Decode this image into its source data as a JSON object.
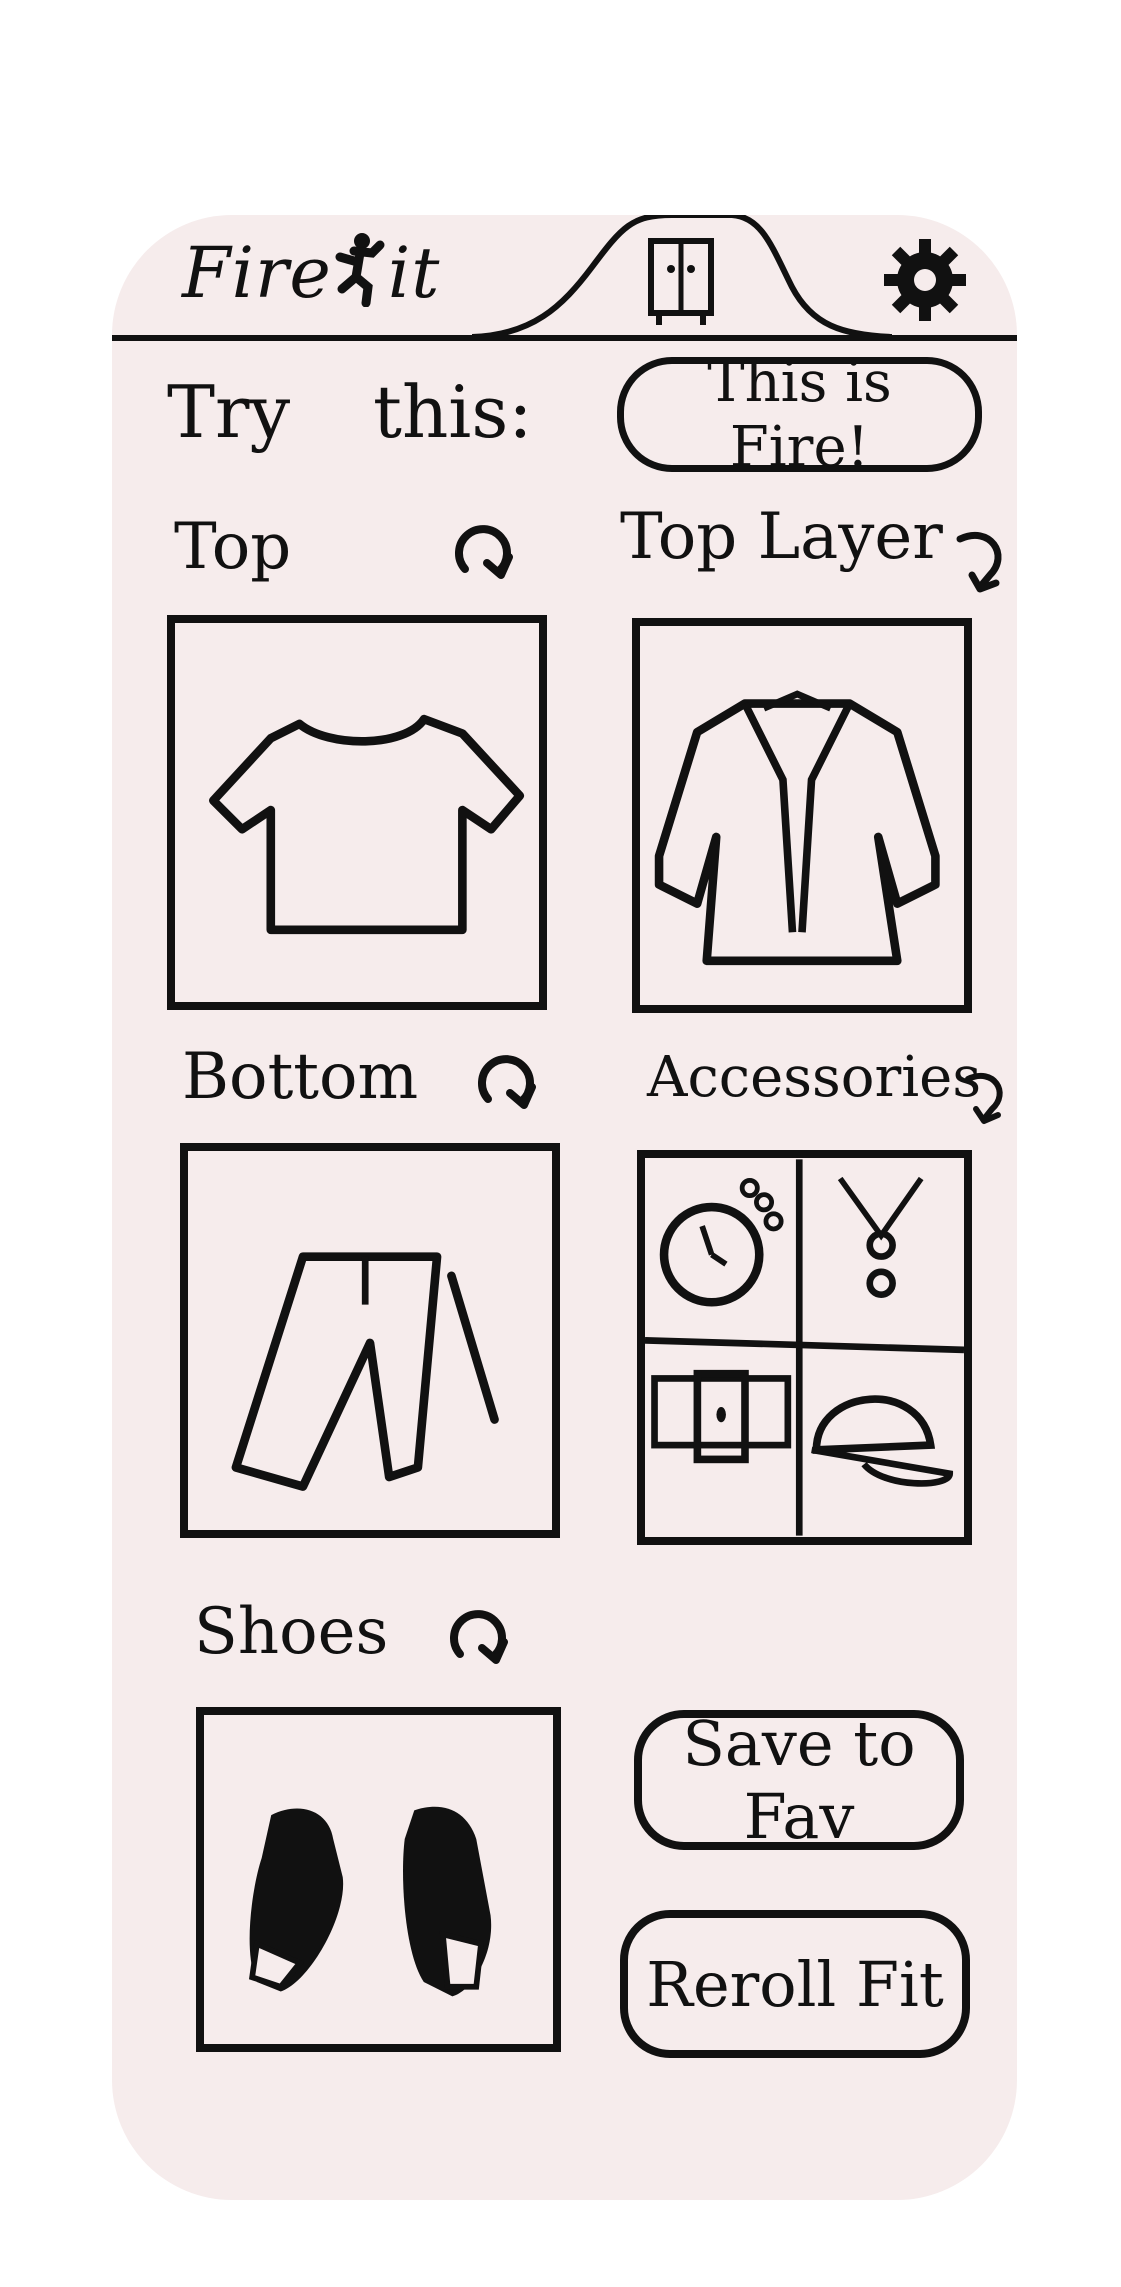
{
  "app": {
    "name": "FireFit",
    "logo_before": "Fire",
    "logo_after": "it"
  },
  "header": {
    "wardrobe_icon": "wardrobe-icon",
    "settings_icon": "gear-icon"
  },
  "suggestion": {
    "label": "Try this:",
    "fire_button": "This is Fire!"
  },
  "sections": {
    "top": {
      "label": "Top",
      "icon": "tshirt-icon"
    },
    "top_layer": {
      "label": "Top Layer",
      "icon": "jacket-icon"
    },
    "bottom": {
      "label": "Bottom",
      "icon": "pants-icon"
    },
    "accessories": {
      "label": "Accessories",
      "icon": "accessories-icon"
    },
    "shoes": {
      "label": "Shoes",
      "icon": "shoes-icon"
    }
  },
  "actions": {
    "save": "Save to Fav",
    "reroll": "Reroll Fit"
  },
  "colors": {
    "background": "#f6ecec",
    "ink": "#111111"
  }
}
